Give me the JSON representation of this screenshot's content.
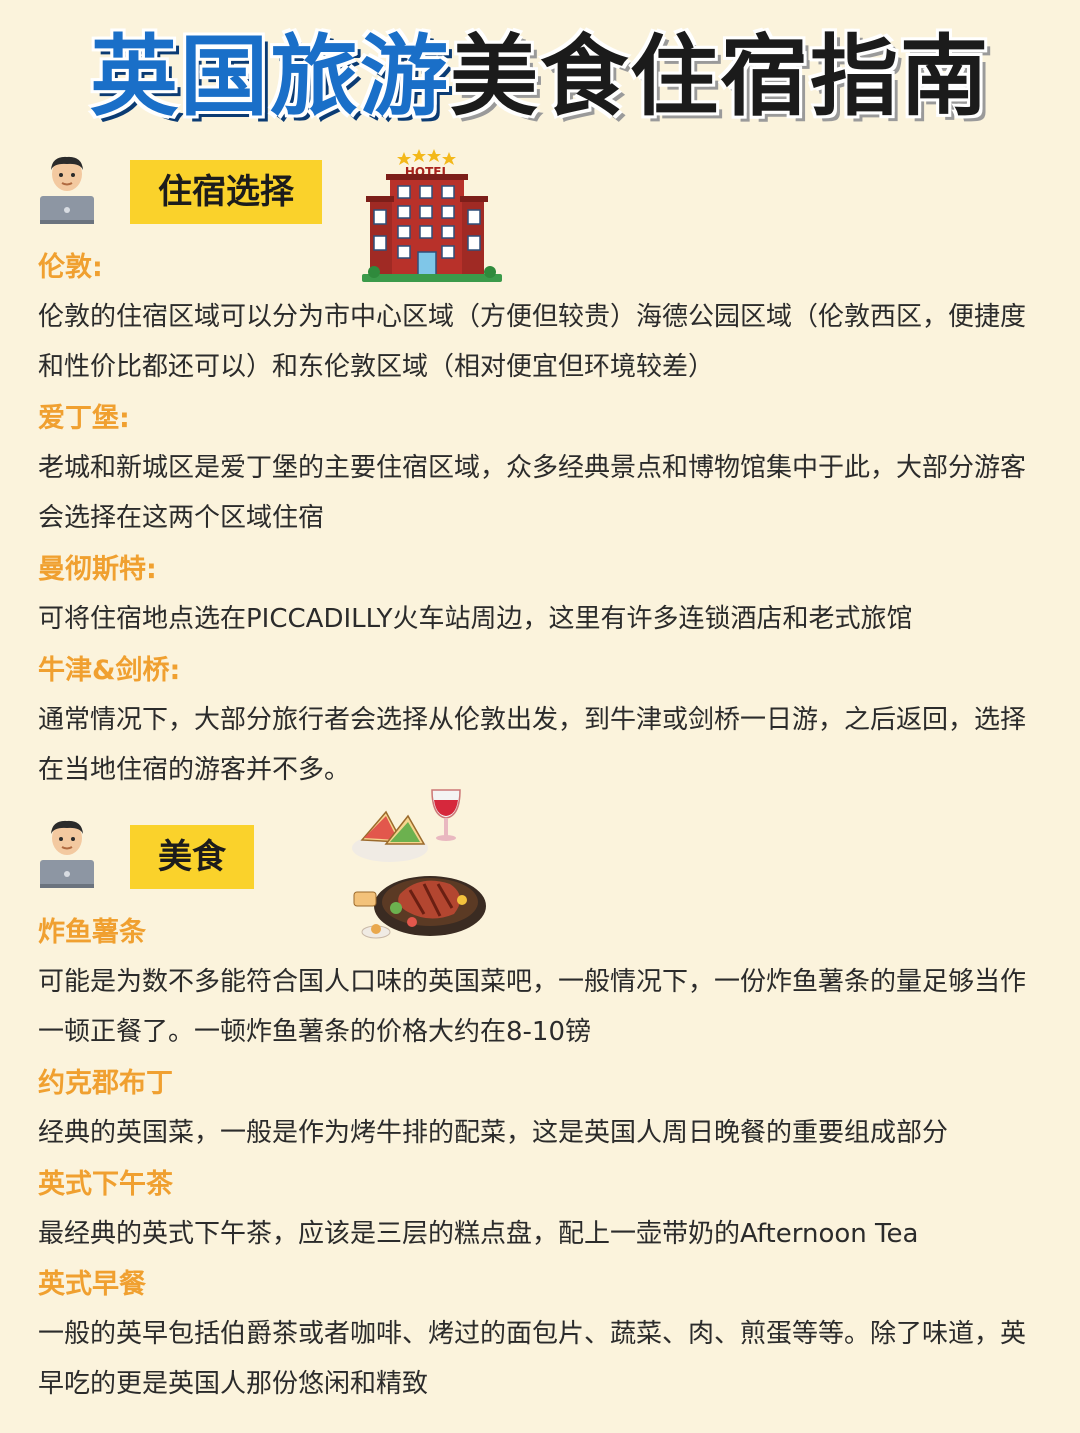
{
  "title": {
    "part1": "英国旅游",
    "part2": "美食住宿指南"
  },
  "lodging": {
    "tag": "住宿选择",
    "hotel_sign": "HOTEL",
    "items": [
      {
        "name": "伦敦:",
        "text": "伦敦的住宿区域可以分为市中心区域（方便但较贵）海德公园区域（伦敦西区，便捷度和性价比都还可以）和东伦敦区域（相对便宜但环境较差）"
      },
      {
        "name": "爱丁堡:",
        "text": "老城和新城区是爱丁堡的主要住宿区域，众多经典景点和博物馆集中于此，大部分游客会选择在这两个区域住宿"
      },
      {
        "name": "曼彻斯特:",
        "text": "可将住宿地点选在PICCADILLY火车站周边，这里有许多连锁酒店和老式旅馆"
      },
      {
        "name": "牛津&剑桥:",
        "text": "通常情况下，大部分旅行者会选择从伦敦出发，到牛津或剑桥一日游，之后返回，选择在当地住宿的游客并不多。"
      }
    ]
  },
  "food": {
    "tag": "美食",
    "items": [
      {
        "name": "炸鱼薯条",
        "text": "可能是为数不多能符合国人口味的英国菜吧，一般情况下，一份炸鱼薯条的量足够当作一顿正餐了。一顿炸鱼薯条的价格大约在8-10镑"
      },
      {
        "name": "约克郡布丁",
        "text": "经典的英国菜，一般是作为烤牛排的配菜，这是英国人周日晚餐的重要组成部分"
      },
      {
        "name": "英式下午茶",
        "text": "最经典的英式下午茶，应该是三层的糕点盘，配上一壶带奶的Afternoon Tea"
      },
      {
        "name": "英式早餐",
        "text": "一般的英早包括伯爵茶或者咖啡、烤过的面包片、蔬菜、肉、煎蛋等等。除了味道，英早吃的更是英国人那份悠闲和精致"
      }
    ]
  },
  "colors": {
    "background": "#fbf3dc",
    "title_blue": "#1a6fc8",
    "tag_yellow": "#fad22b",
    "subheading_orange": "#f0a030"
  }
}
